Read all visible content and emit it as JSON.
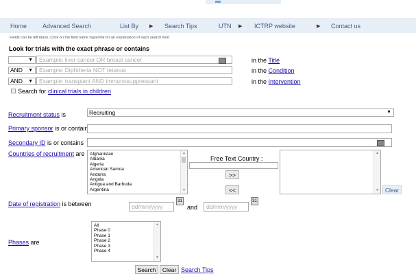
{
  "nav": {
    "home": "Home",
    "advanced_search": "Advanced Search",
    "list_by": "List By",
    "search_tips": "Search Tips",
    "utn": "UTN",
    "ictrp": "ICTRP website",
    "contact": "Contact us"
  },
  "note": "Fields can be left blank. Click on the field name hyperlink for an explanation of each search field",
  "heading": "Look for trials with the exact phrase or contains",
  "rows": [
    {
      "op": "",
      "placeholder": "Example: liver cancer OR breast cancer",
      "in_text": "in the ",
      "field_link": "Title"
    },
    {
      "op": "AND",
      "placeholder": "Example: Diphtheria NOT tetanus",
      "in_text": "in the ",
      "field_link": "Condition"
    },
    {
      "op": "AND",
      "placeholder": "Example: transplant AND immunosuppressant",
      "in_text": "in the ",
      "field_link": "Intervention"
    }
  ],
  "children": {
    "prefix": "Search for ",
    "link": "clinical trials in children"
  },
  "recruitment": {
    "link": "Recruitment status",
    "suffix": " is",
    "value": "Recruiting"
  },
  "sponsor": {
    "link": "Primary sponsor",
    "suffix": " is or contains"
  },
  "secondary": {
    "link": "Secondary ID",
    "suffix": " is or contains"
  },
  "countries": {
    "link": "Countries of recruitment",
    "suffix": " are",
    "list": [
      "Afghanistan",
      "Albania",
      "Algeria",
      "American Samoa",
      "Andorra",
      "Angola",
      "Antigua and Barbuda",
      "Argentina"
    ],
    "free_text_label": "Free Text Country :",
    "add_btn": ">>",
    "remove_btn": "<<",
    "clear_btn": "Clear"
  },
  "registration": {
    "link": "Date of registration",
    "suffix": " is between",
    "from_placeholder": "dd/mm/yyyy",
    "and": "and",
    "to_placeholder": "dd/mm/yyyy"
  },
  "phases": {
    "link": "Phases",
    "suffix": " are",
    "list": [
      "All",
      "Phase 0",
      "Phase 1",
      "Phase 2",
      "Phase 3",
      "Phase 4"
    ]
  },
  "actions": {
    "search": "Search",
    "clear": "Clear",
    "tips": "Search Tips"
  }
}
